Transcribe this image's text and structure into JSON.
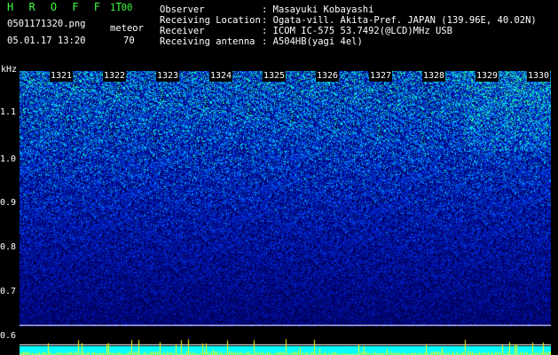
{
  "header": {
    "app_title": "H R O F F T",
    "version": "1.00",
    "filename": "0501171320.png",
    "mode_label": "meteor",
    "datetime": "05.01.17 13:20",
    "count": "70",
    "fields": [
      {
        "label": "Observer",
        "value": ": Masayuki Kobayashi"
      },
      {
        "label": "Receiving Location",
        "value": ": Ogata-vill. Akita-Pref. JAPAN (139.96E, 40.02N)"
      },
      {
        "label": "Receiver",
        "value": ": ICOM IC-575 53.7492(@LCD)MHz USB"
      },
      {
        "label": "Receiving antenna",
        "value": ": A504HB(yagi 4el)"
      }
    ]
  },
  "spectrogram": {
    "y_unit": "kHz",
    "y_ticks": [
      "1.1",
      "1.0",
      "0.9",
      "0.8",
      "0.7",
      "0.6"
    ],
    "time_ticks": [
      "1321",
      "1322",
      "1323",
      "1324",
      "1325",
      "1326",
      "1327",
      "1328",
      "1329",
      "1330"
    ]
  },
  "colors": {
    "background": "#000000",
    "title_green": "#3cff3c",
    "spectrogram_low": "#000a6e",
    "spectrogram_mid": "#0050ff",
    "spectrogram_high": "#00ffc8",
    "baseline_cyan": "#00ffff",
    "peak_yellow": "#ffff00"
  }
}
